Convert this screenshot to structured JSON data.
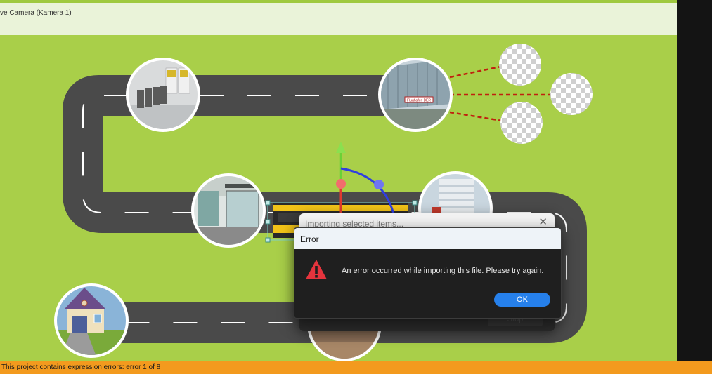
{
  "viewport": {
    "camera_label": "ve Camera (Kamera 1)",
    "station_sign": "Flughafen BER"
  },
  "back_dialog": {
    "title": "Importing selected items...",
    "close_glyph": "✕",
    "stop_label": "Stop"
  },
  "error_dialog": {
    "title": "Error",
    "message": "An error occurred while importing this file. Please try again.",
    "ok_label": "OK",
    "icon": "warning-icon"
  },
  "status_bar": {
    "text": "This project contains expression errors: error 1 of 8"
  },
  "colors": {
    "background_green": "#a9cf49",
    "road": "#4a4a4a",
    "status_orange": "#f39a1e",
    "ok_blue": "#2680eb",
    "warning_red": "#e5343d",
    "gizmo_red": "#e03a2f",
    "gizmo_green": "#6bd136",
    "gizmo_blue": "#2f3ee0"
  }
}
